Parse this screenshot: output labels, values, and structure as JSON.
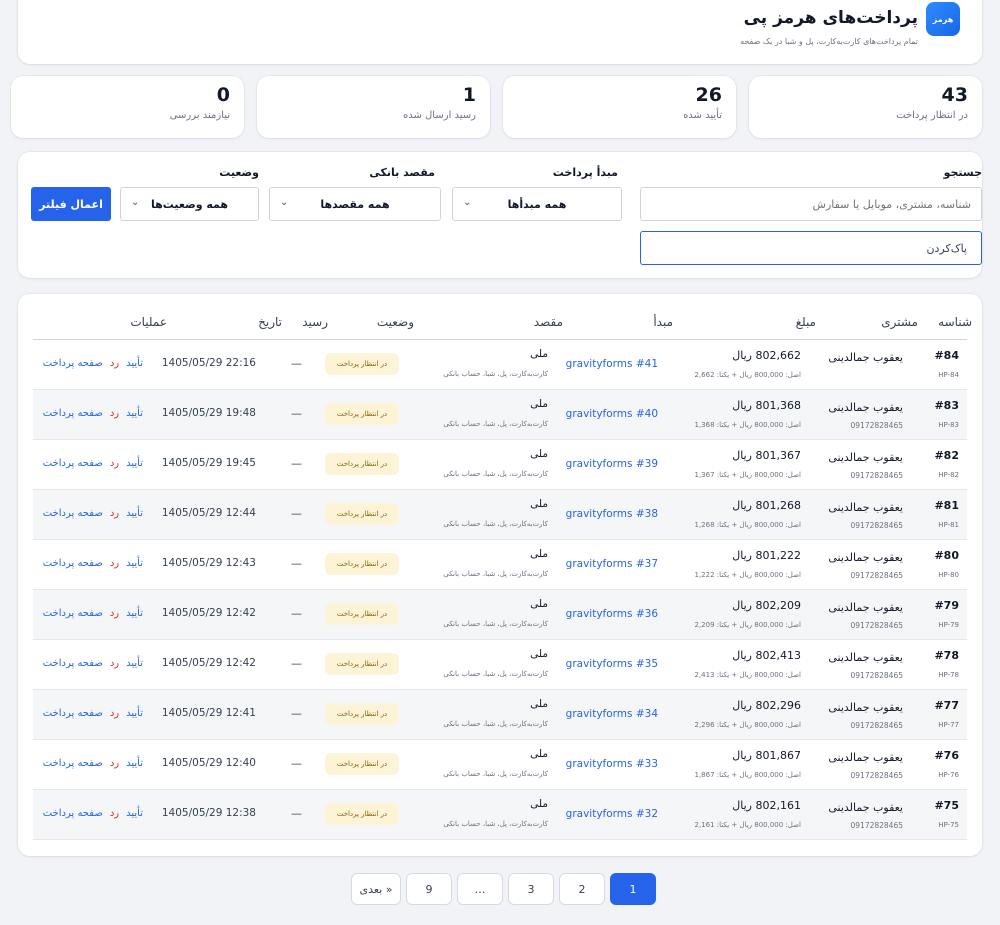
{
  "header": {
    "title": "پرداخت‌های هرمز پی",
    "subtitle": "تمام پرداخت‌های کارت‌به‌کارت، پل و شبا در یک صفحه",
    "logo_text": "هرمز"
  },
  "stats": [
    {
      "value": "43",
      "label": "در انتظار پرداخت"
    },
    {
      "value": "26",
      "label": "تأیید شده"
    },
    {
      "value": "1",
      "label": "رسید ارسال شده"
    },
    {
      "value": "0",
      "label": "نیازمند بررسی"
    }
  ],
  "filters": {
    "search_label": "جستجو",
    "search_placeholder": "شناسه، مشتری، موبایل یا سفارش",
    "origin_label": "مبدأ پرداخت",
    "origin_value": "همه مبدأها",
    "dest_label": "مقصد بانکی",
    "dest_value": "همه مقصدها",
    "status_label": "وضعیت",
    "status_value": "همه وضعیت‌ها",
    "apply_label": "اعمال فیلتر",
    "clear_label": "پاک‌کردن"
  },
  "table": {
    "headers": [
      "شناسه",
      "مشتری",
      "مبلغ",
      "مبدأ",
      "مقصد",
      "وضعیت",
      "رسید",
      "تاریخ",
      "عملیات"
    ],
    "rows": [
      {
        "id": "#84",
        "code": "HP-84",
        "customer": "یعقوب جمالدینی",
        "phone": "",
        "amount": "802,662 ریال",
        "breakdown": "اصل: 800,000 ریال + یکتا: 2,662",
        "origin": "gravityforms #41",
        "dest": "ملی",
        "dest_methods": "کارت‌به‌کارت، پل، شبا، حساب بانکی",
        "status": "در انتظار پرداخت",
        "receipt": "—",
        "date": "1405/05/29 22:16"
      },
      {
        "id": "#83",
        "code": "HP-83",
        "customer": "یعقوب جمالدینی",
        "phone": "09172828465",
        "amount": "801,368 ریال",
        "breakdown": "اصل: 800,000 ریال + یکتا: 1,368",
        "origin": "gravityforms #40",
        "dest": "ملی",
        "dest_methods": "کارت‌به‌کارت، پل، شبا، حساب بانکی",
        "status": "در انتظار پرداخت",
        "receipt": "—",
        "date": "1405/05/29 19:48"
      },
      {
        "id": "#82",
        "code": "HP-82",
        "customer": "یعقوب جمالدینی",
        "phone": "09172828465",
        "amount": "801,367 ریال",
        "breakdown": "اصل: 800,000 ریال + یکتا: 1,367",
        "origin": "gravityforms #39",
        "dest": "ملی",
        "dest_methods": "کارت‌به‌کارت، پل، شبا، حساب بانکی",
        "status": "در انتظار پرداخت",
        "receipt": "—",
        "date": "1405/05/29 19:45"
      },
      {
        "id": "#81",
        "code": "HP-81",
        "customer": "یعقوب جمالدینی",
        "phone": "09172828465",
        "amount": "801,268 ریال",
        "breakdown": "اصل: 800,000 ریال + یکتا: 1,268",
        "origin": "gravityforms #38",
        "dest": "ملی",
        "dest_methods": "کارت‌به‌کارت، پل، شبا، حساب بانکی",
        "status": "در انتظار پرداخت",
        "receipt": "—",
        "date": "1405/05/29 12:44"
      },
      {
        "id": "#80",
        "code": "HP-80",
        "customer": "یعقوب جمالدینی",
        "phone": "09172828465",
        "amount": "801,222 ریال",
        "breakdown": "اصل: 800,000 ریال + یکتا: 1,222",
        "origin": "gravityforms #37",
        "dest": "ملی",
        "dest_methods": "کارت‌به‌کارت، پل، شبا، حساب بانکی",
        "status": "در انتظار پرداخت",
        "receipt": "—",
        "date": "1405/05/29 12:43"
      },
      {
        "id": "#79",
        "code": "HP-79",
        "customer": "یعقوب جمالدینی",
        "phone": "09172828465",
        "amount": "802,209 ریال",
        "breakdown": "اصل: 800,000 ریال + یکتا: 2,209",
        "origin": "gravityforms #36",
        "dest": "ملی",
        "dest_methods": "کارت‌به‌کارت، پل، شبا، حساب بانکی",
        "status": "در انتظار پرداخت",
        "receipt": "—",
        "date": "1405/05/29 12:42"
      },
      {
        "id": "#78",
        "code": "HP-78",
        "customer": "یعقوب جمالدینی",
        "phone": "09172828465",
        "amount": "802,413 ریال",
        "breakdown": "اصل: 800,000 ریال + یکتا: 2,413",
        "origin": "gravityforms #35",
        "dest": "ملی",
        "dest_methods": "کارت‌به‌کارت، پل، شبا، حساب بانکی",
        "status": "در انتظار پرداخت",
        "receipt": "—",
        "date": "1405/05/29 12:42"
      },
      {
        "id": "#77",
        "code": "HP-77",
        "customer": "یعقوب جمالدینی",
        "phone": "09172828465",
        "amount": "802,296 ریال",
        "breakdown": "اصل: 800,000 ریال + یکتا: 2,296",
        "origin": "gravityforms #34",
        "dest": "ملی",
        "dest_methods": "کارت‌به‌کارت، پل، شبا، حساب بانکی",
        "status": "در انتظار پرداخت",
        "receipt": "—",
        "date": "1405/05/29 12:41"
      },
      {
        "id": "#76",
        "code": "HP-76",
        "customer": "یعقوب جمالدینی",
        "phone": "09172828465",
        "amount": "801,867 ریال",
        "breakdown": "اصل: 800,000 ریال + یکتا: 1,867",
        "origin": "gravityforms #33",
        "dest": "ملی",
        "dest_methods": "کارت‌به‌کارت، پل، شبا، حساب بانکی",
        "status": "در انتظار پرداخت",
        "receipt": "—",
        "date": "1405/05/29 12:40"
      },
      {
        "id": "#75",
        "code": "HP-75",
        "customer": "یعقوب جمالدینی",
        "phone": "09172828465",
        "amount": "802,161 ریال",
        "breakdown": "اصل: 800,000 ریال + یکتا: 2,161",
        "origin": "gravityforms #32",
        "dest": "ملی",
        "dest_methods": "کارت‌به‌کارت، پل، شبا، حساب بانکی",
        "status": "در انتظار پرداخت",
        "receipt": "—",
        "date": "1405/05/29 12:38"
      }
    ],
    "actions": {
      "approve": "تأیید",
      "reject": "رد",
      "page": "صفحه پرداخت"
    }
  },
  "pagination": {
    "pages": [
      "1",
      "2",
      "3",
      "…",
      "9"
    ],
    "current": "1",
    "next_label": "بعدی »"
  },
  "colors": {
    "accent": "#2563eb",
    "reject": "#dc2626",
    "pending_bg": "#fdf3d6",
    "pending_text": "#8a6100"
  }
}
